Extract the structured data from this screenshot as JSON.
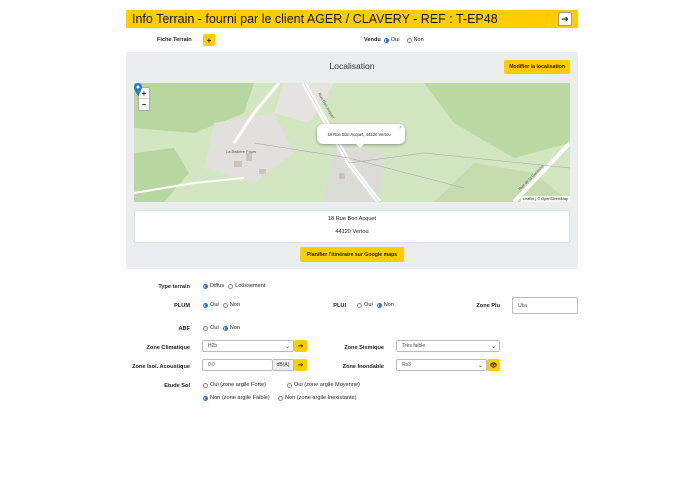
{
  "header": {
    "title": "Info Terrain - fourni par le client AGER / CLAVERY - REF : T-EP48",
    "arrow": "➔"
  },
  "fiche": {
    "label": "Fiche Terrain",
    "plus": "+"
  },
  "vendu": {
    "label": "Vendu",
    "options": [
      "Oui",
      "Non"
    ],
    "selected": "Oui"
  },
  "localisation": {
    "title": "Localisation",
    "modify_label": "Modifier la localisation",
    "zoom_in": "+",
    "zoom_out": "−",
    "popup_text": "18 Rue Bon Acquet, 44120 Vertou",
    "popup_close": "×",
    "attribution": "Leaflet | © OpenStreetMap",
    "map_labels": [
      "La Baillère Fours",
      "Rue Bon Acquet",
      "Rue de la Garenne"
    ],
    "address_line1": "18 Rue Bon Acquet",
    "address_line2": "44120  Vertou",
    "route_label": "Planifier l'itinéraire sur Google maps"
  },
  "form": {
    "type_terrain": {
      "label": "Type terrain",
      "options": [
        "Diffus",
        "Lotissement"
      ],
      "selected": "Diffus"
    },
    "plum": {
      "label": "PLUM",
      "options": [
        "Oui",
        "Non"
      ],
      "selected": "Oui"
    },
    "plui": {
      "label": "PLUI",
      "options": [
        "Oui",
        "Non"
      ],
      "selected": "Non"
    },
    "zone_plu": {
      "label": "Zone Plu",
      "value": "Uba"
    },
    "abf": {
      "label": "ABF",
      "options": [
        "Oui",
        "Non"
      ],
      "selected": "Non"
    },
    "zone_climatique": {
      "label": "Zone Climatique",
      "value": "H2b"
    },
    "zone_sismique": {
      "label": "Zone Sismique",
      "value": "Très faible"
    },
    "zone_isol": {
      "label": "Zone Isol. Acoustique",
      "value": "0.0",
      "unit": "dB(A)"
    },
    "zone_inondable": {
      "label": "Zone Inondable",
      "value": "Rs3"
    },
    "etude_sol": {
      "label": "Etude Sol",
      "options": [
        "Oui (zone argile Forte)",
        "Oui (zone argile Moyenne)",
        "Non (zone argile Faible)",
        "Non (zone argile Inexistante)"
      ],
      "selected": "Non (zone argile Faible)"
    },
    "arrow": "➔",
    "eye": "👁",
    "chevron": "⌄"
  },
  "colors": {
    "accent": "#ffcc00",
    "radio": "#1a73e8",
    "map_green": "#d3e6c2"
  }
}
